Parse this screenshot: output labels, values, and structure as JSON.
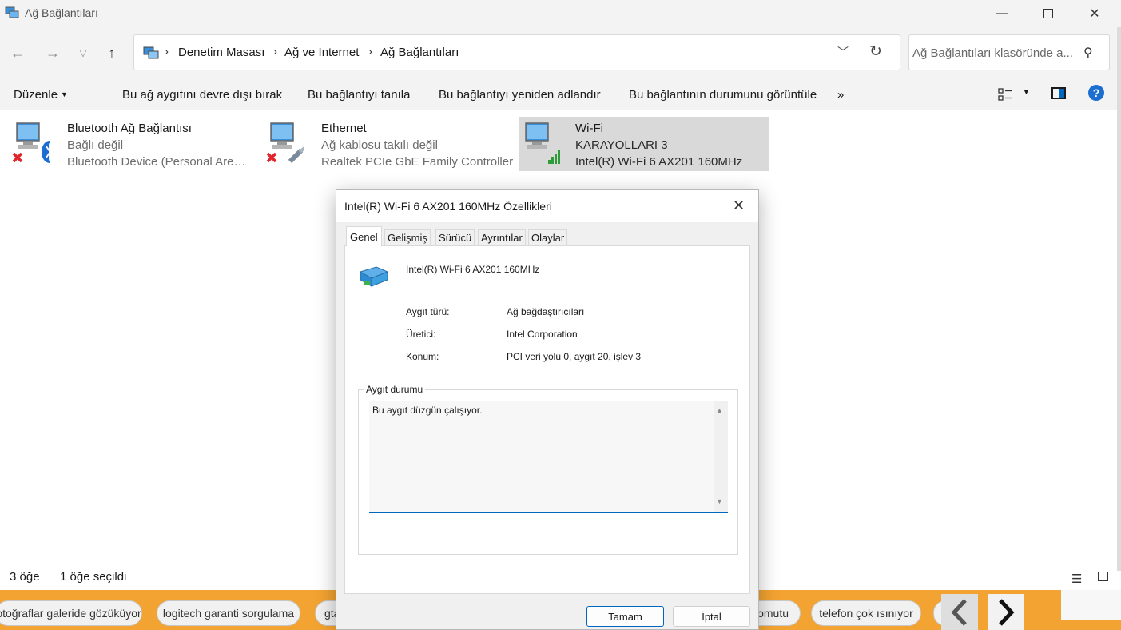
{
  "window": {
    "title": "Ağ Bağlantıları",
    "min_icon": "minimize-icon",
    "max_icon": "maximize-icon",
    "close_icon": "close-icon"
  },
  "address": {
    "breadcrumbs": [
      "Denetim Masası",
      "Ağ ve Internet",
      "Ağ Bağlantıları"
    ],
    "search_placeholder": "Ağ Bağlantıları klasöründe a..."
  },
  "commands": {
    "organize": "Düzenle",
    "disable": "Bu ağ aygıtını devre dışı bırak",
    "diagnose": "Bu bağlantıyı tanıla",
    "rename": "Bu bağlantıyı yeniden adlandır",
    "status": "Bu bağlantının durumunu görüntüle",
    "more": "»"
  },
  "connections": [
    {
      "name": "Bluetooth Ağ Bağlantısı",
      "status": "Bağlı değil",
      "device": "Bluetooth Device (Personal Area ..."
    },
    {
      "name": "Ethernet",
      "status": "Ağ kablosu takılı değil",
      "device": "Realtek PCIe GbE Family Controller"
    },
    {
      "name": "Wi-Fi",
      "status": "KARAYOLLARI 3",
      "device": "Intel(R) Wi-Fi 6 AX201 160MHz"
    }
  ],
  "statusbar": {
    "count": "3 öğe",
    "selected": "1 öğe seçildi"
  },
  "dialog": {
    "title": "Intel(R) Wi-Fi 6 AX201 160MHz Özellikleri",
    "tabs": [
      "Genel",
      "Gelişmiş",
      "Sürücü",
      "Ayrıntılar",
      "Olaylar"
    ],
    "device_name": "Intel(R) Wi-Fi 6 AX201 160MHz",
    "props": [
      {
        "label": "Aygıt türü:",
        "value": "Ağ bağdaştırıcıları"
      },
      {
        "label": "Üretici:",
        "value": "Intel Corporation"
      },
      {
        "label": "Konum:",
        "value": "PCI veri yolu 0, aygıt 20, işlev 3"
      }
    ],
    "status_group_title": "Aygıt durumu",
    "status_text": "Bu aygıt düzgün çalışıyor.",
    "ok": "Tamam",
    "cancel": "İptal"
  },
  "chips": [
    "otoğraflar galeride gözüküyor",
    "logitech garanti sorgulama",
    "gta",
    "omutu",
    "telefon çok ısınıyor"
  ],
  "colors": {
    "accent": "#0067c0",
    "help": "#1c6fd1",
    "taskbar": "#f3a331"
  }
}
